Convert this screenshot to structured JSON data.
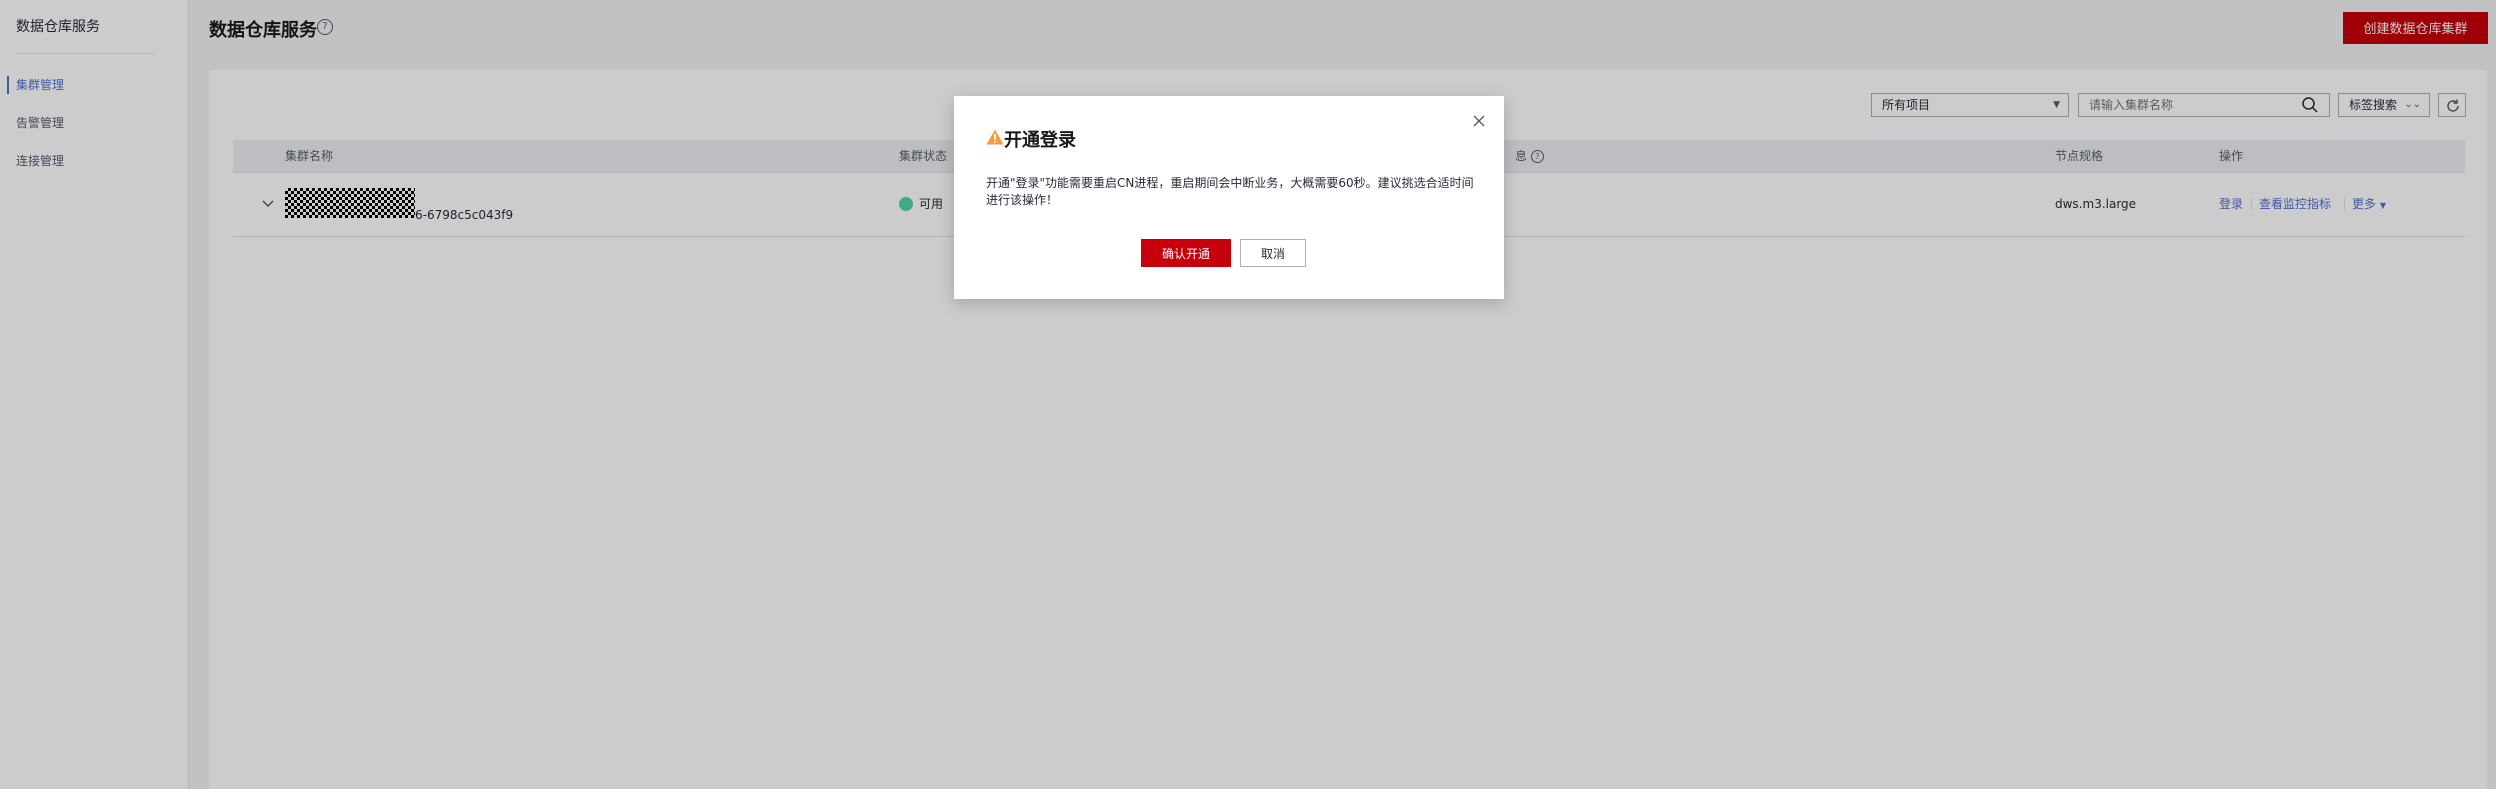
{
  "sidebar": {
    "service_title": "数据仓库服务",
    "items": [
      {
        "label": "集群管理",
        "active": true
      },
      {
        "label": "告警管理",
        "active": false
      },
      {
        "label": "连接管理",
        "active": false
      }
    ]
  },
  "header": {
    "title": "数据仓库服务",
    "create_button": "创建数据仓库集群"
  },
  "toolbar": {
    "project_select": "所有项目",
    "search_placeholder": "请输入集群名称",
    "tag_search": "标签搜索"
  },
  "table": {
    "columns": [
      "集群名称",
      "集群状态",
      "息",
      "节点规格",
      "操作"
    ],
    "rows": [
      {
        "name_suffix": "6-6798c5c043f9",
        "status": "可用",
        "node_spec": "dws.m3.large",
        "ops": [
          "登录",
          "查看监控指标",
          "更多"
        ]
      }
    ]
  },
  "dialog": {
    "title": "开通登录",
    "message": "开通\"登录\"功能需要重启CN进程，重启期间会中断业务，大概需要60秒。建议挑选合适时间进行该操作！",
    "confirm": "确认开通",
    "cancel": "取消"
  },
  "colors": {
    "brand_red": "#c7000b",
    "link_blue": "#526ecc",
    "status_green": "#50d4ab",
    "warning_orange": "#fa9841"
  }
}
